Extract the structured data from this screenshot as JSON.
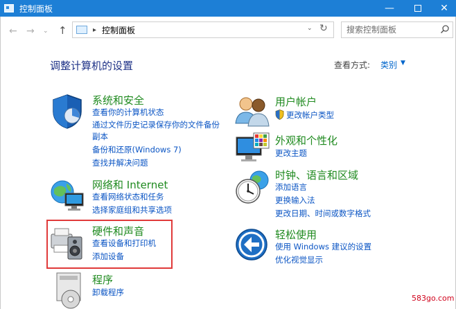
{
  "window": {
    "title": "控制面板",
    "minimize": "—",
    "close": "✕"
  },
  "nav": {
    "back": "←",
    "forward": "→",
    "recent": "⌄",
    "up": "↑",
    "breadcrumb_sep": "▸",
    "breadcrumb": "控制面板",
    "dropdown": "⌄",
    "refresh": "↻",
    "search_placeholder": "搜索控制面板"
  },
  "header": {
    "heading": "调整计算机的设置",
    "view_by_label": "查看方式:",
    "view_by_value": "类别",
    "view_by_arrow": "▼"
  },
  "categories_left": [
    {
      "title": "系统和安全",
      "icon": "shield-icon",
      "links": [
        "查看你的计算机状态",
        "通过文件历史记录保存你的文件备份",
        "副本",
        "备份和还原(Windows 7)",
        "查找并解决问题"
      ]
    },
    {
      "title": "网络和 Internet",
      "icon": "network-globe-icon",
      "links": [
        "查看网络状态和任务",
        "选择家庭组和共享选项"
      ]
    },
    {
      "title": "硬件和声音",
      "icon": "printer-speaker-icon",
      "links": [
        "查看设备和打印机",
        "添加设备"
      ]
    },
    {
      "title": "程序",
      "icon": "programs-disc-icon",
      "links": [
        "卸载程序"
      ]
    }
  ],
  "categories_right": [
    {
      "title": "用户帐户",
      "icon": "users-icon",
      "links": [
        "更改帐户类型"
      ]
    },
    {
      "title": "外观和个性化",
      "icon": "monitor-palette-icon",
      "links": [
        "更改主题"
      ]
    },
    {
      "title": "时钟、语言和区域",
      "icon": "clock-globe-icon",
      "links": [
        "添加语言",
        "更换输入法",
        "更改日期、时间或数字格式"
      ]
    },
    {
      "title": "轻松使用",
      "icon": "accessibility-icon",
      "links": [
        "使用 Windows 建议的设置",
        "优化视觉显示"
      ]
    }
  ],
  "watermark": "583go.com",
  "colors": {
    "titlebar": "#1d7fd6",
    "heading": "#1e3287",
    "category_title": "#1f8a1f",
    "link": "#0b55c4",
    "highlight": "#e03a3a"
  }
}
